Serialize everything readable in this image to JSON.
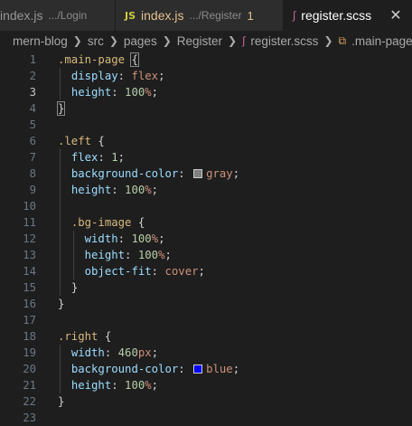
{
  "tabs": [
    {
      "name": "index.js",
      "path": ".../Login",
      "active": false
    },
    {
      "name": "index.js",
      "path": ".../Register",
      "badge": "1",
      "active": false,
      "icon": "JS"
    },
    {
      "name": "register.scss",
      "active": true
    }
  ],
  "breadcrumb": [
    "mern-blog",
    "src",
    "pages",
    "Register",
    "register.scss",
    ".main-page"
  ],
  "colors": {
    "gray_swatch": "#808080",
    "blue_swatch": "#0000ff",
    "sass": "#cd6799"
  },
  "editor": {
    "current_line": 3,
    "lines": [
      {
        "n": "1"
      },
      {
        "n": "2"
      },
      {
        "n": "3"
      },
      {
        "n": "4"
      },
      {
        "n": "5"
      },
      {
        "n": "6"
      },
      {
        "n": "7"
      },
      {
        "n": "8"
      },
      {
        "n": "9"
      },
      {
        "n": "10"
      },
      {
        "n": "11"
      },
      {
        "n": "12"
      },
      {
        "n": "13"
      },
      {
        "n": "14"
      },
      {
        "n": "15"
      },
      {
        "n": "16"
      },
      {
        "n": "17"
      },
      {
        "n": "18"
      },
      {
        "n": "19"
      },
      {
        "n": "20"
      },
      {
        "n": "21"
      },
      {
        "n": "22"
      },
      {
        "n": "23"
      }
    ],
    "tokens": {
      "main_page": ".main-page",
      "left": ".left",
      "bg_image": ".bg-image",
      "right": ".right",
      "display": "display",
      "flex_val": "flex",
      "height": "height",
      "width": "width",
      "flex": "flex",
      "background_color": "background-color",
      "object_fit": "object-fit",
      "cover": "cover",
      "gray": "gray",
      "blue": "blue",
      "n100": "100",
      "n1": "1",
      "n460": "460",
      "pct": "%",
      "px": "px"
    }
  }
}
